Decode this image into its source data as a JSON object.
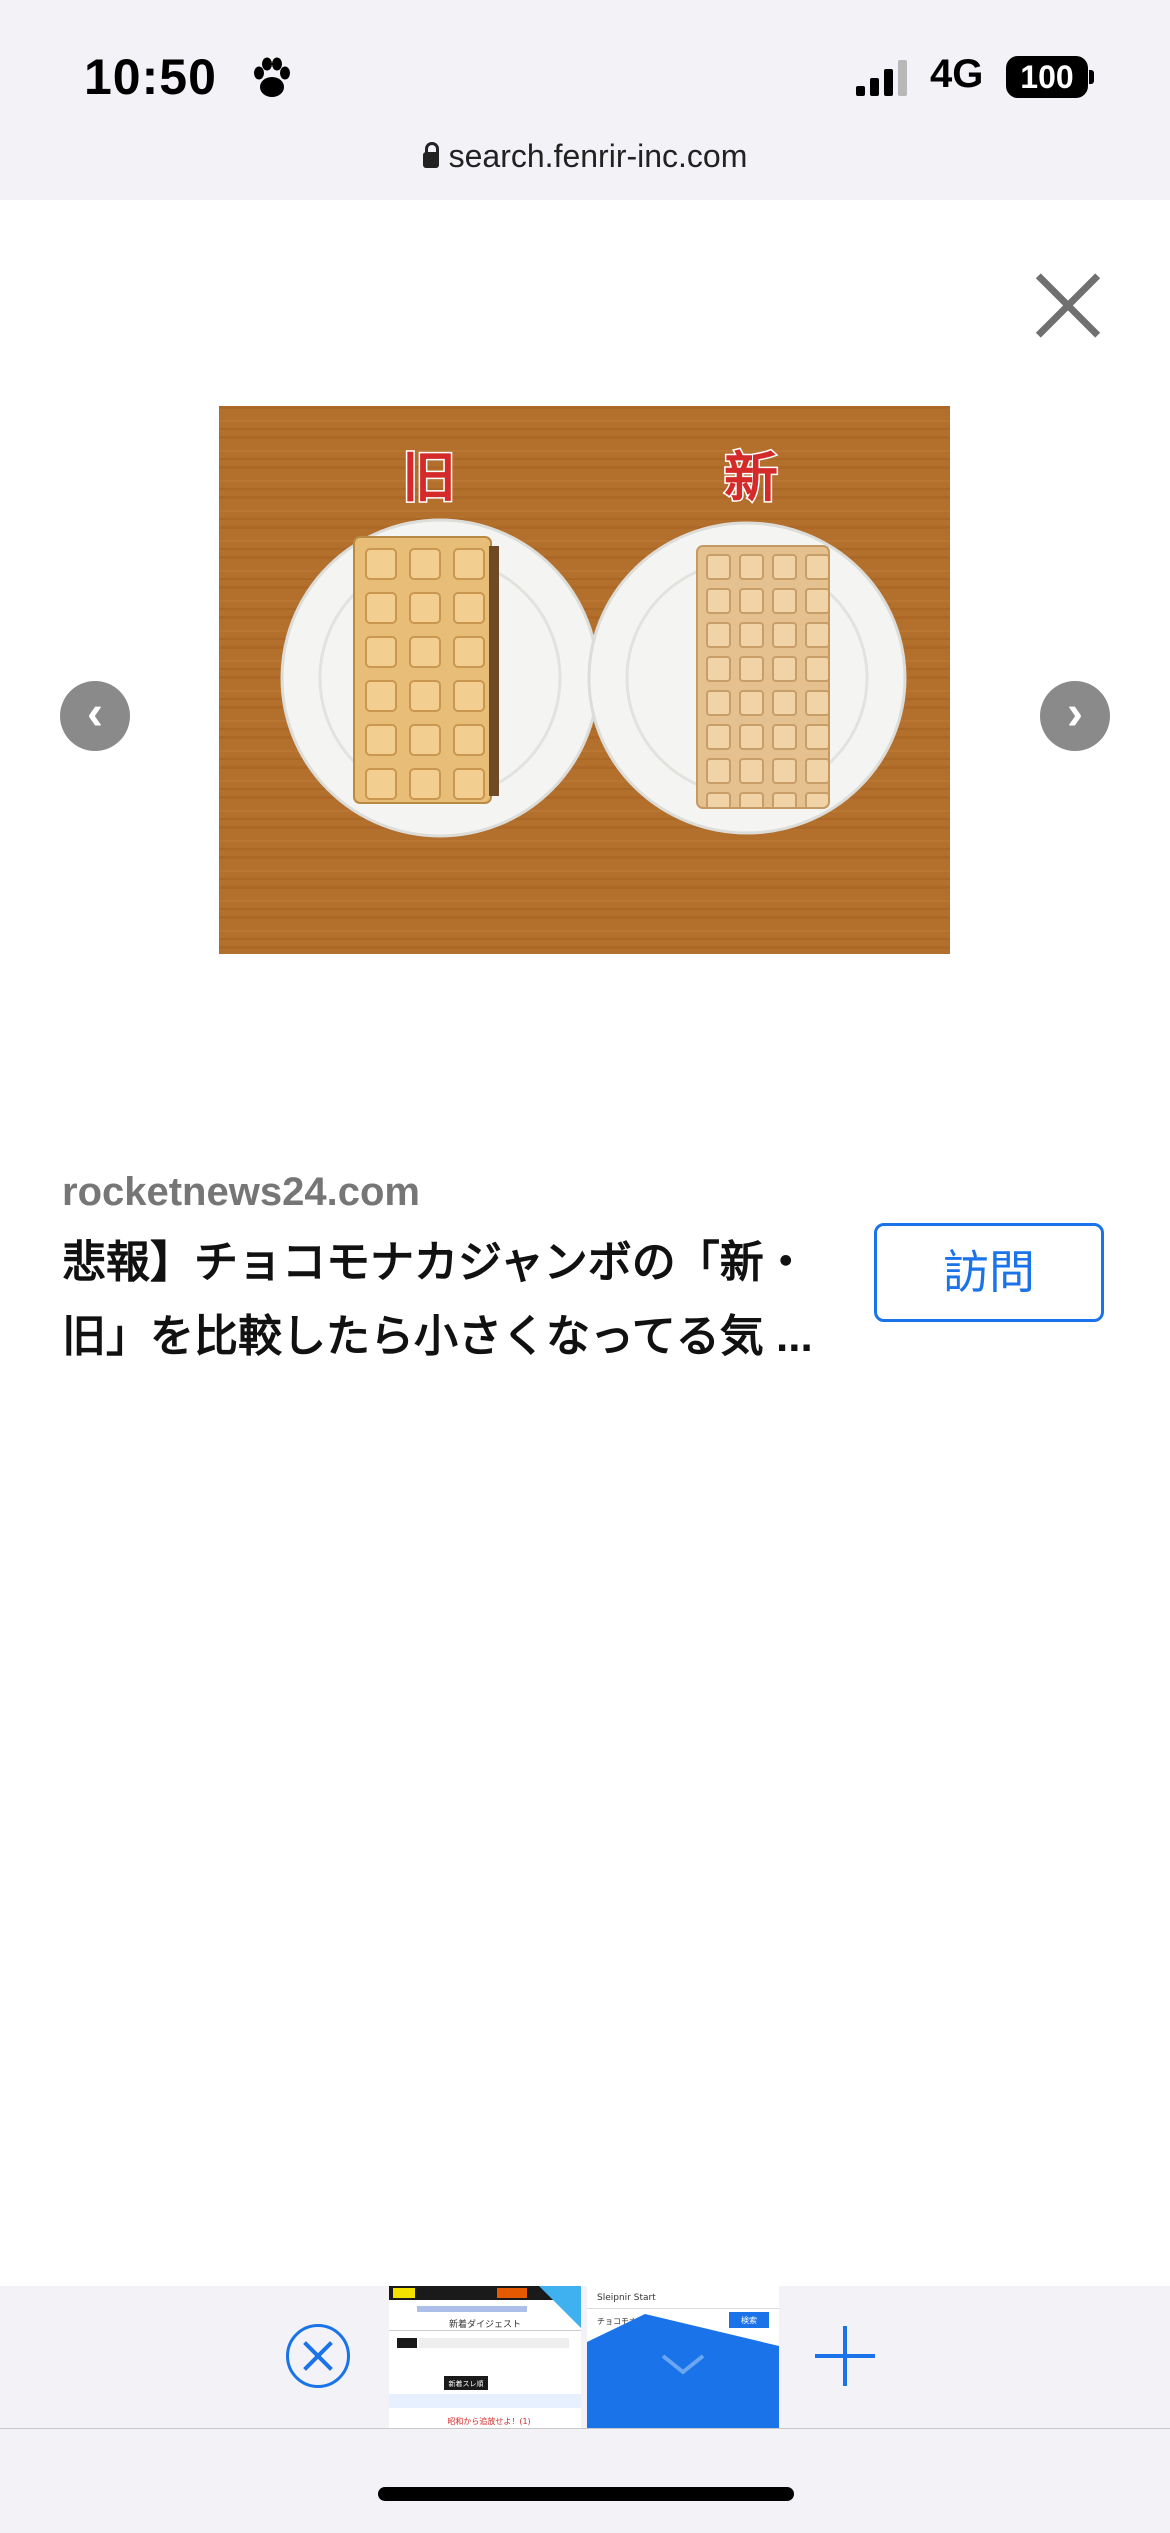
{
  "status_bar": {
    "time": "10:50",
    "network": "4G",
    "battery": "100"
  },
  "browser": {
    "url": "search.fenrir-inc.com"
  },
  "image_viewer": {
    "image_labels": {
      "left": "旧",
      "right": "新"
    },
    "prev_arrow": "‹",
    "next_arrow": "›"
  },
  "result": {
    "domain": "rocketnews24.com",
    "title": "悲報】チョコモナカジャンボの「新・旧」を比較したら小さくなってる気 ...",
    "visit_label": "訪問"
  },
  "tab_thumbs": [
    {
      "header": "新着ダイジェスト",
      "badge": "新着スレ順",
      "link": "昭和から追放せよ！(1)"
    },
    {
      "header": "Sleipnir Start",
      "search": "検索",
      "text": "チョコモナカ"
    }
  ],
  "colors": {
    "accent": "#1a73e8",
    "photo_label": "#d42a2a"
  }
}
